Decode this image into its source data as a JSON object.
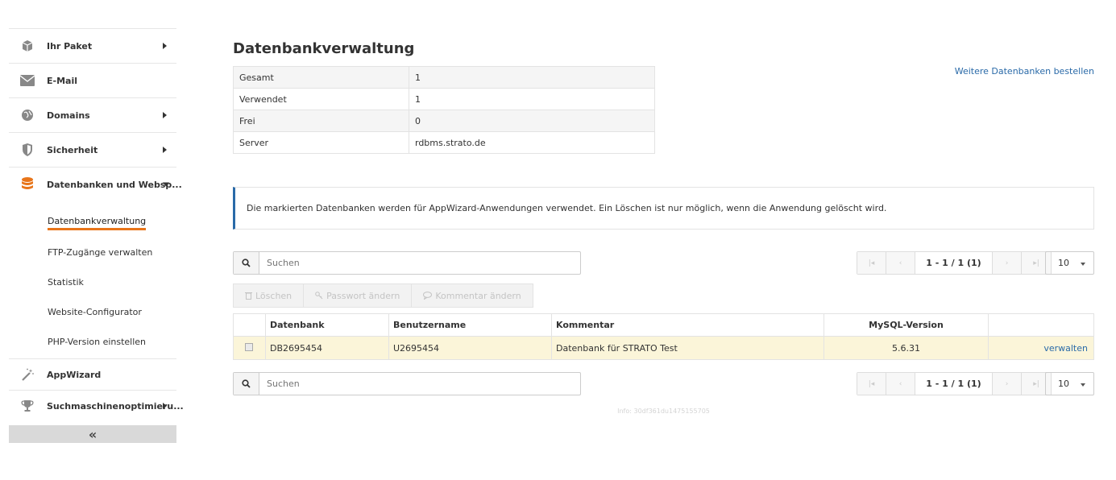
{
  "sidebar": {
    "items": [
      {
        "label": "Ihr Paket"
      },
      {
        "label": "E-Mail"
      },
      {
        "label": "Domains"
      },
      {
        "label": "Sicherheit"
      },
      {
        "label": "Datenbanken und Websp..."
      }
    ],
    "subitems": [
      {
        "label": "Datenbankverwaltung"
      },
      {
        "label": "FTP-Zugänge verwalten"
      },
      {
        "label": "Statistik"
      },
      {
        "label": "Website-Configurator"
      },
      {
        "label": "PHP-Version einstellen"
      }
    ],
    "bottom_items": [
      {
        "label": "AppWizard"
      },
      {
        "label": "Suchmaschinenoptimieru..."
      }
    ],
    "collapse_label": "«"
  },
  "main": {
    "title": "Datenbankverwaltung",
    "order_link": "Weitere Datenbanken bestellen",
    "summary": [
      {
        "key": "Gesamt",
        "value": "1"
      },
      {
        "key": "Verwendet",
        "value": "1"
      },
      {
        "key": "Frei",
        "value": "0"
      },
      {
        "key": "Server",
        "value": "rdbms.strato.de"
      }
    ],
    "notice": "Die markierten Datenbanken werden für AppWizard-Anwendungen verwendet. Ein Löschen ist nur möglich, wenn die Anwendung gelöscht wird.",
    "search_placeholder": "Suchen",
    "pager_info": "1 - 1 / 1 (1)",
    "page_size": "10",
    "actions": {
      "delete": "Löschen",
      "change_password": "Passwort ändern",
      "change_comment": "Kommentar ändern"
    },
    "table": {
      "headers": {
        "db": "Datenbank",
        "user": "Benutzername",
        "comment": "Kommentar",
        "mysql": "MySQL-Version"
      },
      "rows": [
        {
          "db": "DB2695454",
          "user": "U2695454",
          "comment": "Datenbank für STRATO Test",
          "mysql": "5.6.31",
          "action": "verwalten"
        }
      ]
    },
    "footer_info": "Info: 30df361du1475155705"
  },
  "colors": {
    "accent": "#e8751a",
    "link": "#2a6aa8",
    "highlight_row": "#fbf5d9"
  }
}
